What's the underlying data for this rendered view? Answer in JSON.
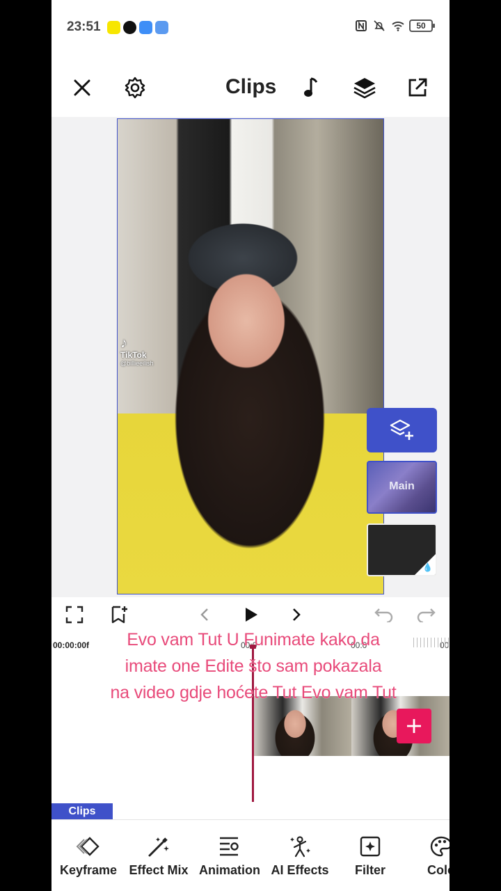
{
  "status_bar": {
    "time": "23:51",
    "battery": "50",
    "notification_icons": [
      "snapchat-icon",
      "tiktok-icon",
      "youtube-icon",
      "video-app-icon"
    ],
    "system_icons": [
      "nfc-icon",
      "bell-off-icon",
      "wifi-icon",
      "battery-icon"
    ]
  },
  "header": {
    "title": "Clips",
    "close_icon": "close-icon",
    "settings_icon": "gear-icon",
    "music_icon": "music-note-icon",
    "layers_icon": "layers-icon",
    "export_icon": "export-icon"
  },
  "preview": {
    "watermark": "TikTok",
    "watermark_user": "@billieeilish"
  },
  "layers": {
    "add_label": "add-layer-icon",
    "main_label": "Main"
  },
  "timeline": {
    "timecode": "00:00:00f",
    "ruler_mid": "00:0",
    "ruler_right1": "00:0",
    "ruler_right2": "00",
    "overlay_line1": "Evo vam Tut U Funimate kako da",
    "overlay_line2": "imate one Edite što sam pokazala",
    "overlay_line3": "na video gdje hoćete Tut Evo vam Tut"
  },
  "mode_tab": "Clips",
  "toolbar": {
    "items": [
      {
        "label": "Keyframe",
        "icon": "keyframe-icon"
      },
      {
        "label": "Effect Mix",
        "icon": "magic-wand-icon"
      },
      {
        "label": "Animation",
        "icon": "animation-icon"
      },
      {
        "label": "AI Effects",
        "icon": "ai-effects-icon"
      },
      {
        "label": "Filter",
        "icon": "filter-icon"
      },
      {
        "label": "Colo",
        "icon": "palette-icon"
      }
    ]
  },
  "colors": {
    "accent": "#3f51c9",
    "add_clip": "#e8185c",
    "overlay_text": "#e84a7a",
    "playhead": "#a01840"
  }
}
